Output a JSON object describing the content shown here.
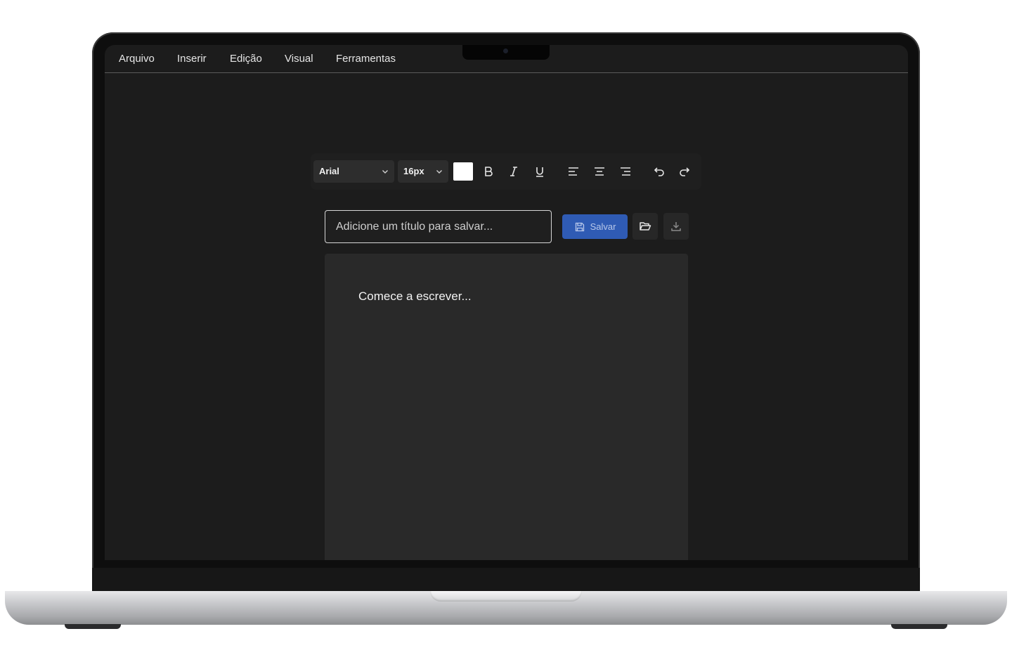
{
  "menu": {
    "items": [
      {
        "label": "Arquivo"
      },
      {
        "label": "Inserir"
      },
      {
        "label": "Edição"
      },
      {
        "label": "Visual"
      },
      {
        "label": "Ferramentas"
      }
    ]
  },
  "toolbar": {
    "font_family": "Arial",
    "font_size": "16px",
    "text_color": "#ffffff",
    "icons": [
      "bold-icon",
      "italic-icon",
      "underline-icon",
      "align-left-icon",
      "align-center-icon",
      "align-right-icon",
      "undo-icon",
      "redo-icon"
    ]
  },
  "document": {
    "title_placeholder": "Adicione um título para salvar...",
    "title_value": "",
    "save_label": "Salvar",
    "body_placeholder": "Comece a escrever..."
  },
  "colors": {
    "accent": "#2f5bb4",
    "background": "#1c1c1c",
    "page": "#292929"
  }
}
